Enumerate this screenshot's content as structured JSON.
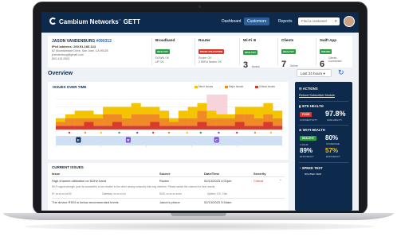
{
  "nav": {
    "brand": "Cambium Networks",
    "product": "GETT",
    "items": [
      "Dashboard",
      "Customers",
      "Reports"
    ],
    "active": "Customers",
    "search_placeholder": "Find a customer"
  },
  "subscriber": {
    "name": "JASON VANDENBURG",
    "id": "#090312",
    "ip": "IPv4 address: 200.91.183.124",
    "address_line1": "62 Mountainside Drive, San Jose, CA 95128",
    "email": "jvandenburg@gmail.com",
    "phone": "802-415-2802"
  },
  "cards": {
    "broadband": {
      "title": "Broadband",
      "badge": "HEALTHY",
      "down": "DOWN",
      "down_status": "OK",
      "up": "UP",
      "up_status": "OK"
    },
    "router": {
      "title": "Router",
      "badge": "POOR UTILIZATION",
      "line1": "Router",
      "line1_status": "OK",
      "line2": "2 WiFi4 Nodes",
      "line2_status": "OK"
    },
    "wifi": {
      "title": "Wi-Fi",
      "badge": "HEALTHY",
      "value": "3",
      "label": "Nodes"
    },
    "clients": {
      "title": "Clients",
      "badge": "HEALTHY",
      "value": "7",
      "label": "Online"
    },
    "swift": {
      "title": "Swift App",
      "badge": "ONLINE",
      "value": "6",
      "label": "Clients Connected"
    }
  },
  "overview": {
    "title": "Overview",
    "range": "Last 24 hours"
  },
  "issues_chart": {
    "title": "ISSUES OVER TIME",
    "legend": [
      "Minor Issues",
      "Major Issues",
      "Critical Issues"
    ],
    "markers": [
      "E",
      "R",
      "C"
    ]
  },
  "chart_data": {
    "type": "area",
    "series": [
      {
        "name": "Minor Issues",
        "values": [
          1,
          1,
          2,
          2,
          1,
          2,
          2,
          3,
          3,
          2,
          2,
          2,
          1,
          2,
          3,
          2,
          2,
          1,
          1,
          2,
          2,
          3,
          3,
          2
        ]
      },
      {
        "name": "Major Issues",
        "values": [
          1,
          2,
          2,
          1,
          2,
          3,
          2,
          2,
          3,
          3,
          2,
          2,
          1,
          2,
          2,
          3,
          2,
          2,
          2,
          2,
          3,
          2,
          2,
          2
        ]
      },
      {
        "name": "Critical Issues",
        "values": [
          1,
          1,
          1,
          2,
          1,
          1,
          2,
          1,
          1,
          1,
          2,
          1,
          1,
          1,
          1,
          2,
          1,
          1,
          1,
          2,
          1,
          1,
          2,
          1
        ]
      }
    ],
    "colors": [
      "#f5c400",
      "#f08a24",
      "#d83a2e"
    ],
    "ylim": [
      0,
      8
    ]
  },
  "actions": {
    "title": "ACTIONS",
    "link": "Reboot Subscriber Module"
  },
  "site_health": {
    "title": "SITE HEALTH",
    "badge": "POOR",
    "metric1_label": "CONNECTIVITY",
    "metric2_value": "97.8%",
    "metric2_label": "AVAILABILITY"
  },
  "wifi_health": {
    "title": "WI-FI HEALTH",
    "badge": "HEALTHY",
    "badge_label": "2.4GHZ",
    "metric1_value": "80%",
    "metric1_label": "COVERAGE",
    "metric2_value": "89%",
    "metric2_label": "EFFICIENCY",
    "metric3_value": "57%",
    "metric3_label": "EFFICIENCY"
  },
  "speed_test": {
    "title": "SPEED TEST",
    "sub": "ROUTER: WAN"
  },
  "current_issues": {
    "title": "CURRENT ISSUES",
    "headers": [
      "Issue",
      "Source",
      "Date/Time",
      "Severity"
    ],
    "rows": [
      {
        "issue": "High channel utilization on 5GHz band",
        "source": "Router",
        "datetime": "02/13/2023  4:01pm",
        "severity": "Critical"
      },
      {
        "issue": "The device RSSI is below recommended levels",
        "source": "Jason's phone",
        "datetime": "02/13/2023  3:54am",
        "severity": ""
      }
    ],
    "detail": "Wi-Fi signal strength (and its bandwidth) is low relative to the other nearby networks that may interfere. Please switch the channel for best results.",
    "detail_fields": [
      "IP: xx.xx.xx.xx/32",
      "Gateway: xx.xx.xx.xx",
      "DNS: xx.xx.xx.xx/xx",
      "Uptime: 17h, 13m"
    ]
  }
}
